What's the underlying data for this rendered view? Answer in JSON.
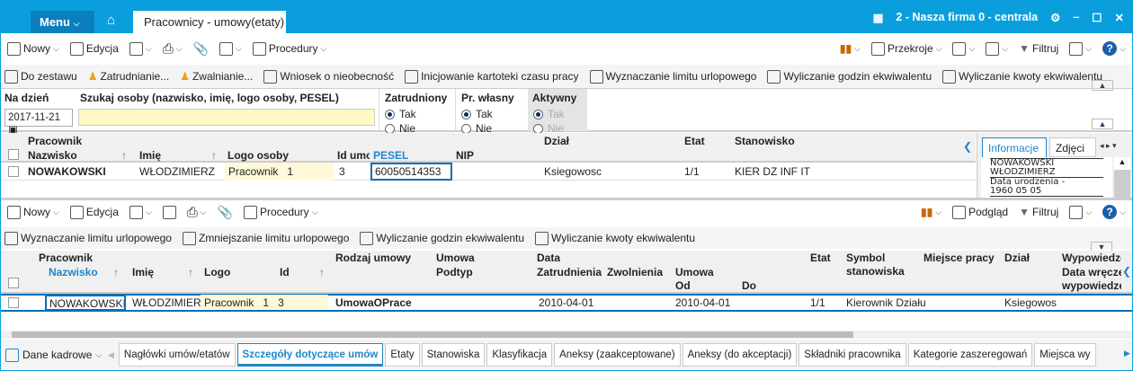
{
  "titlebar": {
    "menu": "Menu",
    "tab": "Pracownicy - umowy(etaty)",
    "company": "2 - Nasza firma 0 - centrala"
  },
  "toolbar1": {
    "new": "Nowy",
    "edit": "Edycja",
    "procedures": "Procedury",
    "sections": "Przekroje",
    "filter": "Filtruj"
  },
  "toolbar2": [
    "Do zestawu",
    "Zatrudnianie...",
    "Zwalnianie...",
    "Wniosek o nieobecność",
    "Inicjowanie kartoteki czasu pracy",
    "Wyznaczanie limitu urlopowego",
    "Wyliczanie godzin ekwiwalentu",
    "Wyliczanie kwoty ekwiwalentu"
  ],
  "filters": {
    "date_label": "Na dzień",
    "date_value": "2017-11-21",
    "search_label": "Szukaj osoby (nazwisko, imię, logo osoby, PESEL)",
    "search_value": "",
    "employed": "Zatrudniony",
    "own": "Pr. własny",
    "active": "Aktywny",
    "yes": "Tak",
    "no": "Nie"
  },
  "upper_grid": {
    "group": "Pracownik",
    "cols": {
      "surname": "Nazwisko",
      "name": "Imię",
      "logo": "Logo osoby",
      "id": "Id umo",
      "pesel": "PESEL",
      "nip": "NIP",
      "dept": "Dział",
      "etat": "Etat",
      "position": "Stanowisko"
    },
    "row": {
      "surname": "NOWAKOWSKI",
      "name": "WŁODZIMIERZ",
      "logo": "Pracownik",
      "logo_n": "1",
      "id": "3",
      "pesel": "60050514353",
      "nip": "",
      "dept": "Ksiegowosc",
      "etat": "1/1",
      "position": "KIER DZ INF IT"
    }
  },
  "info_panel": {
    "tab1": "Informacje",
    "tab2": "Zdjęci",
    "line1": "NOWAKOWSKI",
    "line2": "WŁODZIMIERZ",
    "line3": "Data urodzenia -",
    "line4": "1960 05 05"
  },
  "toolbar3": {
    "new": "Nowy",
    "edit": "Edycja",
    "procedures": "Procedury",
    "preview": "Podgląd",
    "filter": "Filtruj"
  },
  "toolbar4": [
    "Wyznaczanie limitu urlopowego",
    "Zmniejszanie limitu urlopowego",
    "Wyliczanie godzin ekwiwalentu",
    "Wyliczanie kwoty ekwiwalentu"
  ],
  "lower_grid": {
    "group": "Pracownik",
    "cols": {
      "surname": "Nazwisko",
      "name": "Imię",
      "logo": "Logo",
      "id": "Id",
      "type": "Rodzaj umowy",
      "umowa": "Umowa",
      "podtyp": "Podtyp",
      "data": "Data",
      "zatr": "Zatrudnienia",
      "zwol": "Zwolnienia",
      "umowa2": "Umowa",
      "od": "Od",
      "do": "Do",
      "etat": "Etat",
      "symbol": "Symbol stanowiska",
      "place": "Miejsce pracy",
      "dept": "Dział",
      "wyp": "Wypowiedzen",
      "wyp2": "Data wręczen",
      "wyp3": "wypowiedzen"
    },
    "row": {
      "surname": "NOWAKOWSKI",
      "name": "WŁODZIMIERZ",
      "logo": "Pracownik",
      "logo_n": "1",
      "id": "3",
      "type": "UmowaOPrace",
      "podtyp": "",
      "zatr": "2010-04-01",
      "zwol": "",
      "od": "2010-04-01",
      "do": "",
      "etat": "1/1",
      "symbol": "Kierownik Działu",
      "place": "",
      "dept": "Ksiegowos"
    }
  },
  "bottom": {
    "dropdown": "Dane kadrowe",
    "tabs": [
      "Nagłówki umów/etatów",
      "Szczegóły dotyczące umów",
      "Etaty",
      "Stanowiska",
      "Klasyfikacja",
      "Aneksy (zaakceptowane)",
      "Aneksy (do akceptacji)",
      "Składniki pracownika",
      "Kategorie zaszeregowań",
      "Miejsca wy"
    ]
  }
}
